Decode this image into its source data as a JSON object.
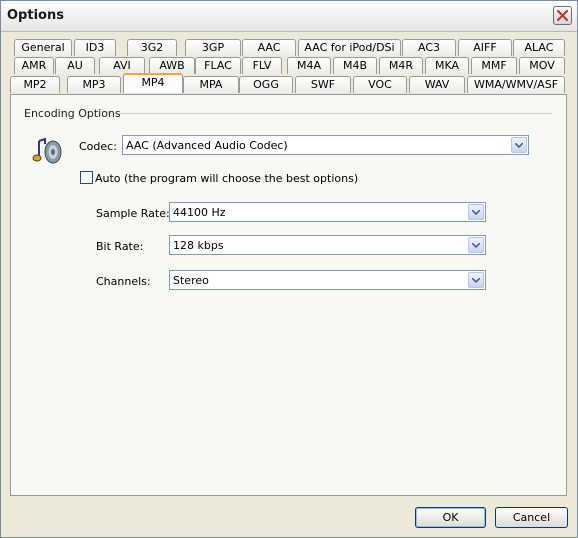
{
  "window": {
    "title": "Options",
    "close_icon": "close-icon"
  },
  "tabs": {
    "row1": [
      "General",
      "ID3",
      "3G2",
      "3GP",
      "AAC",
      "AAC for iPod/DSi",
      "AC3",
      "AIFF",
      "ALAC"
    ],
    "row2": [
      "AMR",
      "AU",
      "AVI",
      "AWB",
      "FLAC",
      "FLV",
      "M4A",
      "M4B",
      "M4R",
      "MKA",
      "MMF",
      "MOV"
    ],
    "row3": [
      "MP2",
      "MP3",
      "MP4",
      "MPA",
      "OGG",
      "SWF",
      "VOC",
      "WAV",
      "WMA/WMV/ASF"
    ],
    "active": "MP4"
  },
  "encoding": {
    "group_label": "Encoding Options",
    "codec_label": "Codec:",
    "codec_value": "AAC (Advanced Audio Codec)",
    "auto_label": "Auto (the program will choose the best options)",
    "auto_checked": false,
    "sample_rate_label": "Sample Rate:",
    "sample_rate_value": "44100 Hz",
    "bit_rate_label": "Bit Rate:",
    "bit_rate_value": "128 kbps",
    "channels_label": "Channels:",
    "channels_value": "Stereo",
    "icon": "audio-speaker-icon"
  },
  "buttons": {
    "ok": "OK",
    "cancel": "Cancel"
  },
  "colors": {
    "accent_tab": "#f0a838",
    "combo_border": "#7f9db9",
    "button_border": "#003c74"
  }
}
